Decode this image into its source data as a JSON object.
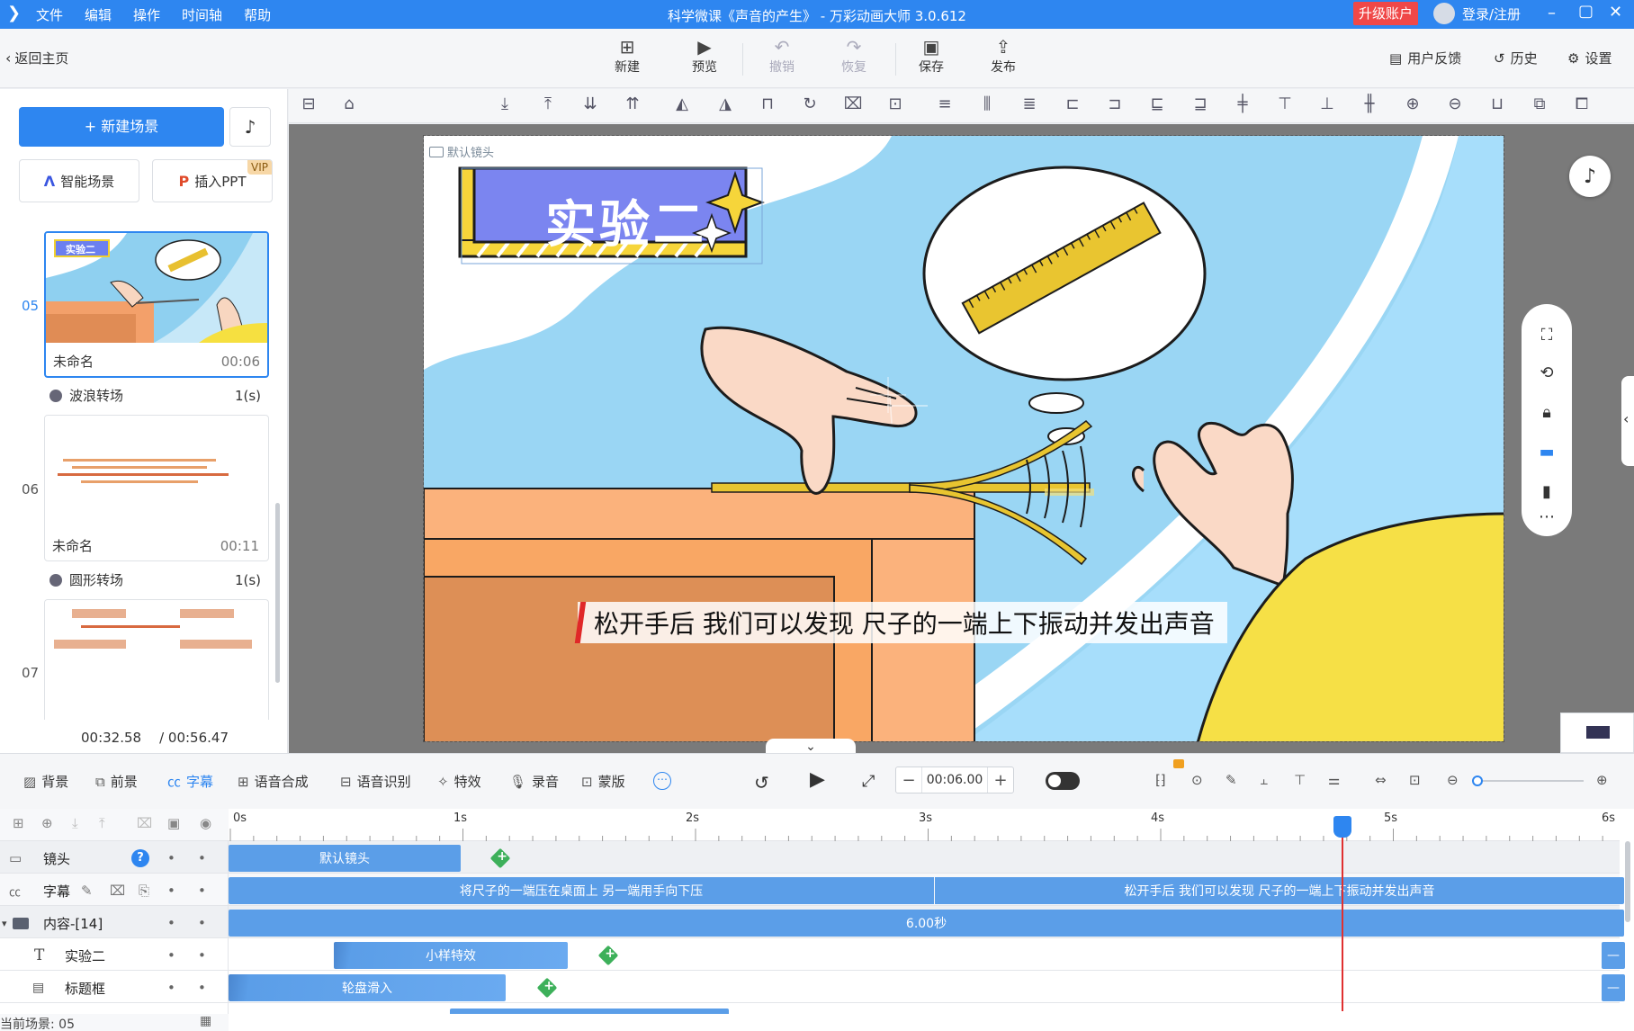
{
  "app": {
    "title": "科学微课《声音的产生》 - 万彩动画大师 3.0.612",
    "menu": [
      "文件",
      "编辑",
      "操作",
      "时间轴",
      "帮助"
    ],
    "upgrade_label": "升级账户",
    "login_label": "登录/注册"
  },
  "toolbar": {
    "back_label": "返回主页",
    "buttons": [
      {
        "label": "新建",
        "icon": "plus-square-icon",
        "enabled": true
      },
      {
        "label": "预览",
        "icon": "play-icon",
        "enabled": true
      },
      {
        "label": "撤销",
        "icon": "undo-icon",
        "enabled": false
      },
      {
        "label": "恢复",
        "icon": "redo-icon",
        "enabled": false
      },
      {
        "label": "保存",
        "icon": "save-icon",
        "enabled": true
      },
      {
        "label": "发布",
        "icon": "publish-icon",
        "enabled": true
      }
    ],
    "feedback_label": "用户反馈",
    "history_label": "历史",
    "settings_label": "设置"
  },
  "left_panel": {
    "new_scene_label": "+ 新建场景",
    "smart_scene_label": "智能场景",
    "insert_ppt_label": "插入PPT",
    "vip_badge": "VIP",
    "scenes": [
      {
        "number": "05",
        "name": "未命名",
        "duration": "00:06",
        "selected": true,
        "thumb_title": "实验二"
      },
      {
        "number": "06",
        "name": "未命名",
        "duration": "00:11",
        "selected": false
      },
      {
        "number": "07",
        "name": "",
        "duration": "",
        "selected": false
      }
    ],
    "transitions": [
      {
        "name": "波浪转场",
        "duration": "1(s)"
      },
      {
        "name": "圆形转场",
        "duration": "1(s)"
      }
    ],
    "current_time": "00:32.58",
    "total_time": "/ 00:56.47"
  },
  "canvas": {
    "camera_label": "默认镜头",
    "title_text": "实验二",
    "subtitle": "松开手后 我们可以发现 尺子的一端上下振动并发出声音"
  },
  "timeline_toolbar": {
    "items": [
      "背景",
      "前景",
      "字幕",
      "语音合成",
      "语音识别",
      "特效",
      "录音",
      "蒙版"
    ],
    "active_item": "字幕",
    "time_value": "00:06.00"
  },
  "timeline": {
    "ruler": [
      "0s",
      "1s",
      "2s",
      "3s",
      "4s",
      "5s",
      "6s"
    ],
    "tracks": [
      {
        "name": "镜头",
        "blocks": [
          {
            "label": "默认镜头"
          }
        ]
      },
      {
        "name": "字幕",
        "blocks": [
          {
            "label": "将尺子的一端压在桌面上 另一端用手向下压"
          },
          {
            "label": "松开手后 我们可以发现 尺子的一端上下振动并发出声音"
          }
        ]
      },
      {
        "name": "内容-[14]",
        "blocks": [
          {
            "label": "6.00秒"
          }
        ]
      },
      {
        "name": "实验二",
        "blocks": [
          {
            "label": "小样特效"
          }
        ]
      },
      {
        "name": "标题框",
        "blocks": [
          {
            "label": "轮盘滑入"
          }
        ]
      }
    ],
    "current_scene_label": "当前场景: 05"
  },
  "colors": {
    "accent": "#2e86f0",
    "upgrade": "#f04848",
    "track_block": "#5b9ee8",
    "playhead": "#e03030",
    "keyframe": "#3db05a"
  }
}
